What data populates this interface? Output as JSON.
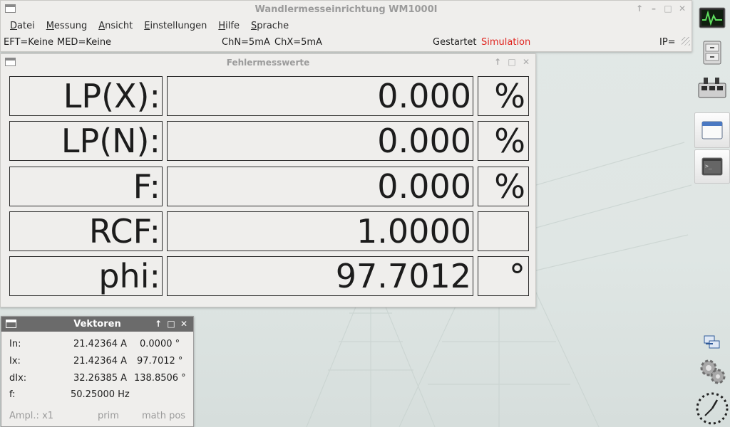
{
  "main_window": {
    "title": "Wandlermesseinrichtung WM1000I",
    "menu": [
      {
        "label": "Datei"
      },
      {
        "label": "Messung"
      },
      {
        "label": "Ansicht"
      },
      {
        "label": "Einstellungen"
      },
      {
        "label": "Hilfe"
      },
      {
        "label": "Sprache"
      }
    ],
    "status": {
      "eft": "EFT=Keine",
      "med": "MED=Keine",
      "chn": "ChN=5mA",
      "chx": "ChX=5mA",
      "state": "Gestartet",
      "mode": "Simulation",
      "ip": "IP="
    }
  },
  "error_window": {
    "title": "Fehlermesswerte",
    "rows": [
      {
        "label": "LP(X):",
        "value": "0.000",
        "unit": "%"
      },
      {
        "label": "LP(N):",
        "value": "0.000",
        "unit": "%"
      },
      {
        "label": "F:",
        "value": "0.000",
        "unit": "%"
      },
      {
        "label": "RCF:",
        "value": "1.0000",
        "unit": ""
      },
      {
        "label": "phi:",
        "value": "97.7012",
        "unit": "°"
      }
    ]
  },
  "vector_window": {
    "title": "Vektoren",
    "rows": [
      {
        "name": "In:",
        "amplitude": "21.42364 A",
        "angle": "0.0000 °"
      },
      {
        "name": "Ix:",
        "amplitude": "21.42364 A",
        "angle": "97.7012 °"
      },
      {
        "name": "dIx:",
        "amplitude": "32.26385 A",
        "angle": "138.8506 °"
      },
      {
        "name": "f:",
        "amplitude": "50.25000 Hz",
        "angle": ""
      }
    ],
    "footer": {
      "ampl": "Ampl.: x1",
      "ref": "prim",
      "mode": "math pos"
    }
  },
  "colors": {
    "simulation": "#e0241f",
    "dock_active_top": "#fdfdfd",
    "vector_titlebar": "#6b6b6b"
  },
  "dock_icons": [
    "system-monitor-icon",
    "file-cabinet-icon",
    "network-switch-icon",
    "window-icon",
    "terminal-icon",
    "network-status-icon",
    "settings-gears-icon",
    "clock-icon"
  ]
}
